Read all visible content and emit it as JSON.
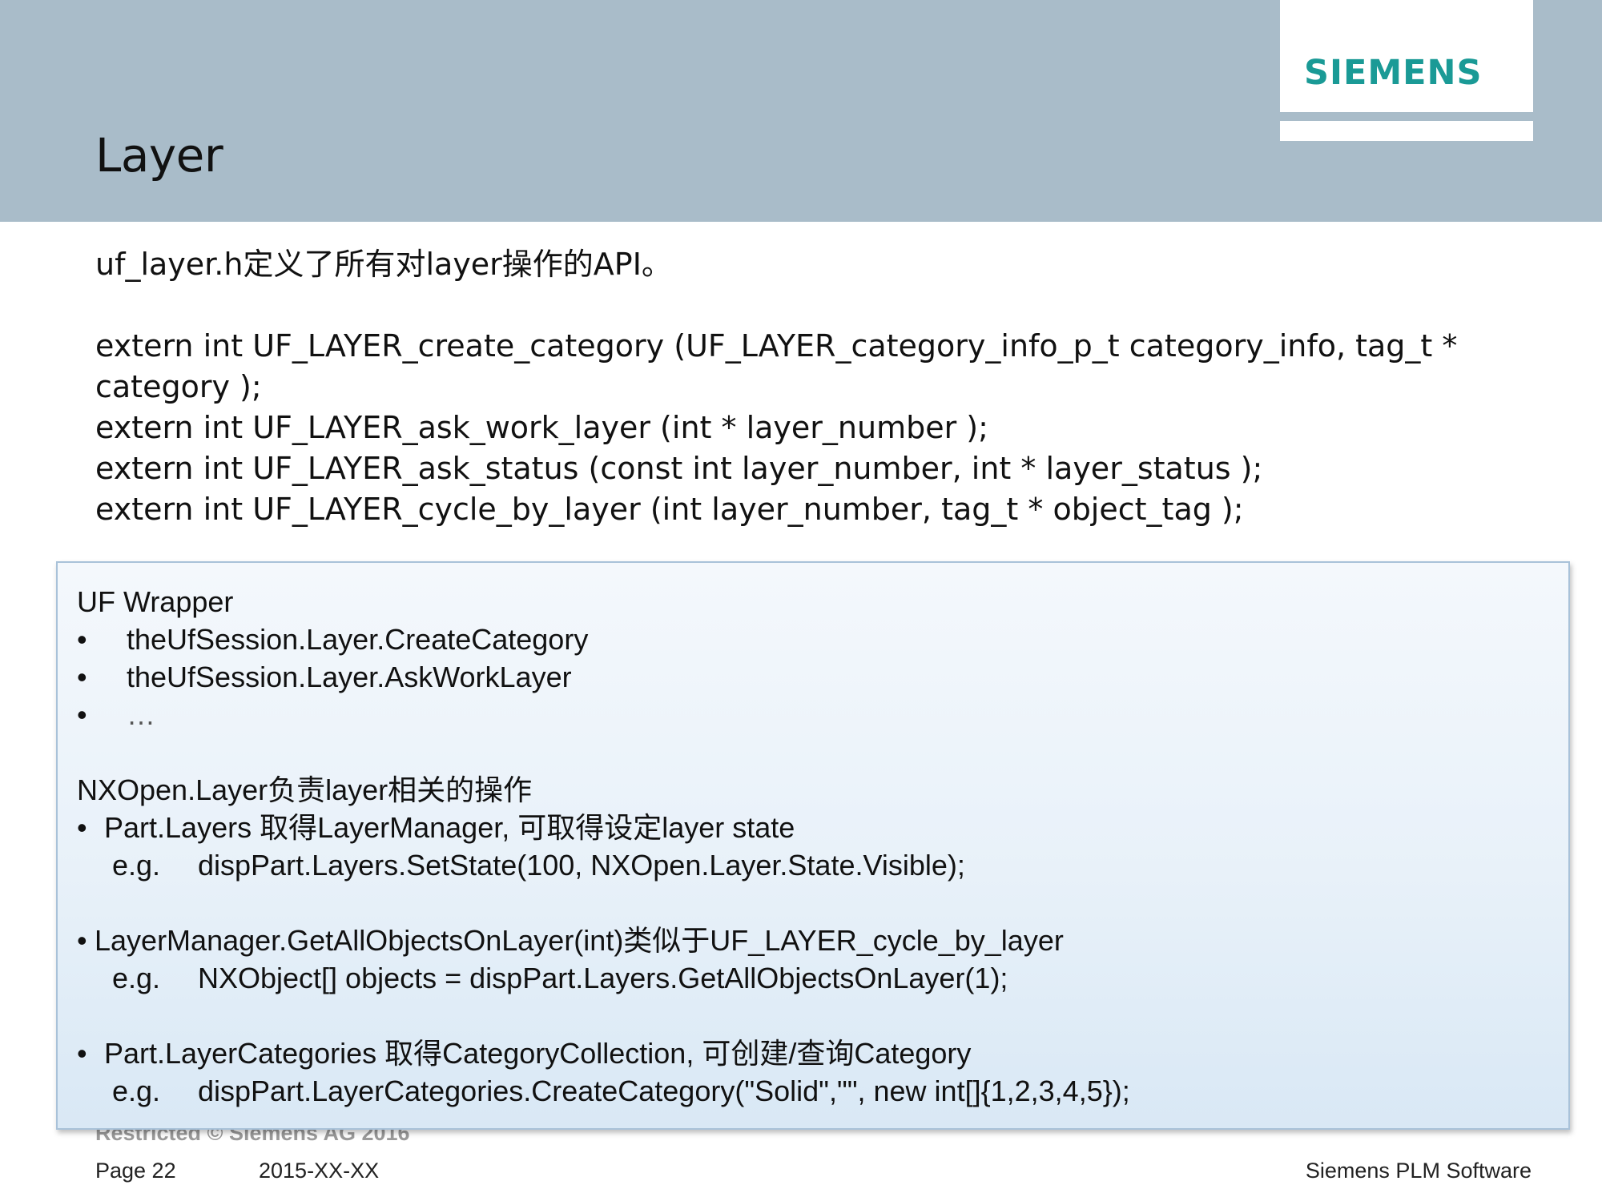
{
  "header": {
    "title": "Layer",
    "logo": "SIEMENS",
    "brand_color": "#1a9a96",
    "band_color": "#a9bcc9"
  },
  "body": {
    "intro": "uf_layer.h定义了所有对layer操作的API。",
    "lines": [
      "extern int UF_LAYER_create_category (UF_LAYER_category_info_p_t category_info, tag_t *",
      "category );",
      "extern int UF_LAYER_ask_work_layer (int * layer_number );",
      "extern int UF_LAYER_ask_status (const int layer_number, int * layer_status );",
      "extern int UF_LAYER_cycle_by_layer (int layer_number, tag_t * object_tag );"
    ]
  },
  "callout": {
    "uf_heading": "UF Wrapper",
    "uf_items": [
      "theUfSession.Layer.CreateCategory",
      "theUfSession.Layer.AskWorkLayer",
      "…"
    ],
    "bullet_symbol": "•",
    "nx_heading": "NXOpen.Layer负责layer相关的操作",
    "nx_items": [
      {
        "text": "Part.Layers 取得LayerManager, 可取得设定layer state",
        "eg_label": "e.g.",
        "eg_code": "dispPart.Layers.SetState(100, NXOpen.Layer.State.Visible);"
      },
      {
        "text": "LayerManager.GetAllObjectsOnLayer(int)类似于UF_LAYER_cycle_by_layer",
        "eg_label": "e.g.",
        "eg_code": "NXObject[] objects = dispPart.Layers.GetAllObjectsOnLayer(1);"
      },
      {
        "text": "Part.LayerCategories 取得CategoryCollection, 可创建/查询Category",
        "eg_label": "e.g.",
        "eg_code": "dispPart.LayerCategories.CreateCategory(\"Solid\",\"\", new int[]{1,2,3,4,5});"
      }
    ]
  },
  "footer": {
    "restricted": "Restricted © Siemens AG 2016",
    "page": "Page 22",
    "date": "2015-XX-XX",
    "company": "Siemens PLM Software"
  }
}
